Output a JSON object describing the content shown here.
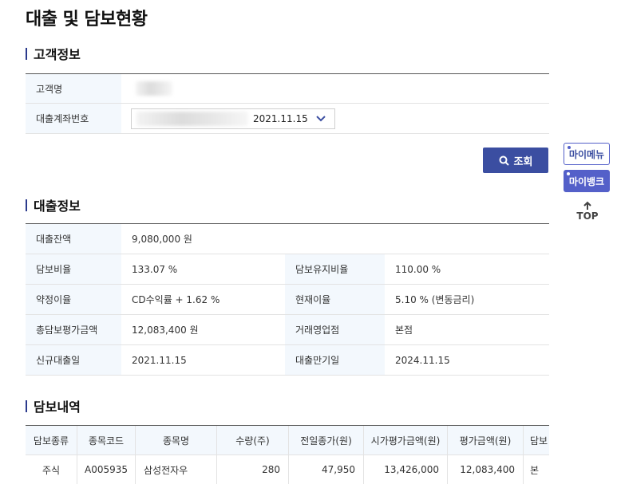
{
  "page": {
    "title": "대출 및 담보현황"
  },
  "customer": {
    "section_title": "고객정보",
    "name_label": "고객명",
    "account_label": "대출계좌번호",
    "account_date": "2021.11.15",
    "search_label": "조회"
  },
  "loan": {
    "section_title": "대출정보",
    "balance_label": "대출잔액",
    "balance": "9,080,000 원",
    "collateral_ratio_label": "담보비율",
    "collateral_ratio": "133.07 %",
    "maintain_ratio_label": "담보유지비율",
    "maintain_ratio": "110.00 %",
    "agreed_rate_label": "약정이율",
    "agreed_rate": "CD수익률 + 1.62 %",
    "current_rate_label": "현재이율",
    "current_rate": "5.10 % (변동금리)",
    "total_eval_label": "총담보평가금액",
    "total_eval": "12,083,400 원",
    "branch_label": "거래영업점",
    "branch": "본점",
    "new_date_label": "신규대출일",
    "new_date": "2021.11.15",
    "maturity_label": "대출만기일",
    "maturity": "2024.11.15"
  },
  "holdings": {
    "section_title": "담보내역",
    "headers": [
      "담보종류",
      "종목코드",
      "종목명",
      "수량(주)",
      "전일종가(원)",
      "시가평가금액(원)",
      "평가금액(원)",
      "담보"
    ],
    "rows": [
      [
        "주식",
        "A005935",
        "삼성전자우",
        "280",
        "47,950",
        "13,426,000",
        "12,083,400",
        "본"
      ]
    ]
  },
  "side": {
    "mymenu": "마이메뉴",
    "mybank": "마이뱅크",
    "top": "TOP"
  },
  "colors": {
    "accent": "#3b4ea1",
    "side_accent": "#5460c9",
    "header_bg": "#f3f8fd"
  }
}
